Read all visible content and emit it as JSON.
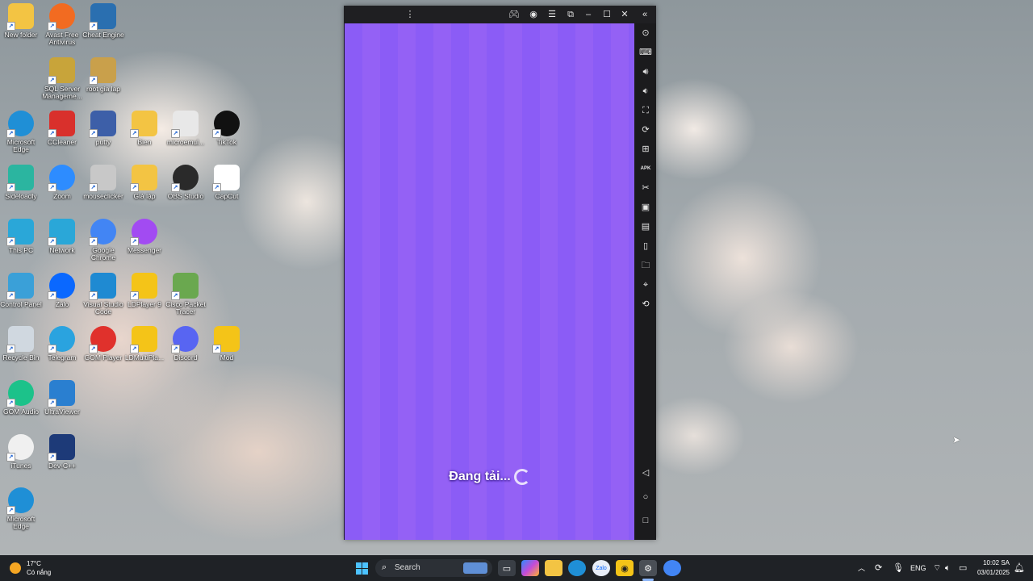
{
  "desktop": {
    "icons": [
      {
        "label": "New folder",
        "icon": "folder-icon",
        "color": "#f3c443"
      },
      {
        "label": "Avast Free Antivirus",
        "icon": "avast-icon",
        "color": "#f26b21"
      },
      {
        "label": "Cheat Engine",
        "icon": "cheat-engine-icon",
        "color": "#2a6fb0"
      },
      {
        "label": "SQL Server Manageme...",
        "icon": "sql-server-icon",
        "color": "#c8a43a"
      },
      {
        "label": "root gia lap",
        "icon": "folder-icon",
        "color": "#c9a04b"
      },
      {
        "label": "Microsoft Edge",
        "icon": "edge-icon",
        "color": "#1f8fd6"
      },
      {
        "label": "CCleaner",
        "icon": "ccleaner-icon",
        "color": "#d9302c"
      },
      {
        "label": "putty",
        "icon": "putty-icon",
        "color": "#3d5fa8"
      },
      {
        "label": "Bien",
        "icon": "folder-icon",
        "color": "#f3c443"
      },
      {
        "label": "microemul...",
        "icon": "java-icon",
        "color": "#e8e8e8"
      },
      {
        "label": "TikTok",
        "icon": "tiktok-icon",
        "color": "#111111"
      },
      {
        "label": "Sideloadly",
        "icon": "sideloadly-icon",
        "color": "#2bb5a0"
      },
      {
        "label": "Zoom",
        "icon": "zoom-icon",
        "color": "#2d8cff"
      },
      {
        "label": "mouseclicker",
        "icon": "mouse-icon",
        "color": "#c8c8c8"
      },
      {
        "label": "Giả lập",
        "icon": "folder-icon",
        "color": "#f3c443"
      },
      {
        "label": "OBS Studio",
        "icon": "obs-icon",
        "color": "#2a2a2a"
      },
      {
        "label": "CapCut",
        "icon": "capcut-icon",
        "color": "#ffffff"
      },
      {
        "label": "This PC",
        "icon": "monitor-icon",
        "color": "#2aa7d8"
      },
      {
        "label": "Network",
        "icon": "network-icon",
        "color": "#2aa7d8"
      },
      {
        "label": "Google Chrome",
        "icon": "chrome-icon",
        "color": "#4285f4"
      },
      {
        "label": "Messenger",
        "icon": "messenger-icon",
        "color": "#a24bf2"
      },
      {
        "label": "Control Panel",
        "icon": "control-panel-icon",
        "color": "#3aa0d8"
      },
      {
        "label": "Zalo",
        "icon": "zalo-icon",
        "color": "#0a68ff"
      },
      {
        "label": "Visual Studio Code",
        "icon": "vscode-icon",
        "color": "#1f8ad2"
      },
      {
        "label": "LDPlayer 9",
        "icon": "ldplayer-icon",
        "color": "#f4c418"
      },
      {
        "label": "Cisco Packet Tracer",
        "icon": "cisco-icon",
        "color": "#6aa84f"
      },
      {
        "label": "Recycle Bin",
        "icon": "recycle-bin-icon",
        "color": "#d0d8e0"
      },
      {
        "label": "Telegram",
        "icon": "telegram-icon",
        "color": "#2aa3df"
      },
      {
        "label": "GOM Player",
        "icon": "gom-player-icon",
        "color": "#e0312c"
      },
      {
        "label": "LDMultiPla...",
        "icon": "ldmultiplayer-icon",
        "color": "#f4c418"
      },
      {
        "label": "Discord",
        "icon": "discord-icon",
        "color": "#5865f2"
      },
      {
        "label": "Mod",
        "icon": "ldplayer-icon",
        "color": "#f4c418"
      },
      {
        "label": "GOM Audio",
        "icon": "gom-audio-icon",
        "color": "#1cc28a"
      },
      {
        "label": "UltraViewer",
        "icon": "ultraviewer-icon",
        "color": "#2a7fd0"
      },
      {
        "label": "iTunes",
        "icon": "itunes-icon",
        "color": "#f0f0f0"
      },
      {
        "label": "Dev-C++",
        "icon": "devcpp-icon",
        "color": "#1d3a78"
      },
      {
        "label": "Microsoft Edge",
        "icon": "edge-icon",
        "color": "#1f8fd6"
      }
    ]
  },
  "emulator": {
    "loading_text": "Đang tải...",
    "screen_color": "#8b5cf6",
    "titlebar_buttons": [
      "more-options-icon",
      "gamepad-icon",
      "account-icon",
      "menu-icon",
      "resize-icon",
      "minimize-icon",
      "maximize-icon",
      "close-icon",
      "collapse-sidebar-icon"
    ],
    "sidebar_buttons": [
      "settings-icon",
      "keyboard-icon",
      "volume-up-icon",
      "volume-down-icon",
      "screenshot-icon",
      "sync-icon",
      "record-icon",
      "apk-icon",
      "cut-icon",
      "multi-instance-icon",
      "operation-record-icon",
      "shake-icon",
      "folder-icon",
      "location-icon",
      "rotate-icon"
    ],
    "nav_buttons": [
      "back-icon",
      "home-icon",
      "recent-apps-icon"
    ],
    "apk_text": "APK"
  },
  "taskbar": {
    "weather_temp": "17°C",
    "weather_desc": "Có nắng",
    "search_placeholder": "Search",
    "apps": [
      "start-icon",
      "search-icon",
      "taskview-icon",
      "copilot-icon",
      "file-explorer-icon",
      "edge-icon",
      "zalo-icon",
      "ldplayer-icon",
      "cheat-engine-icon",
      "chrome-icon"
    ],
    "language": "ENG",
    "time": "10:02 SA",
    "date": "03/01/2025"
  }
}
